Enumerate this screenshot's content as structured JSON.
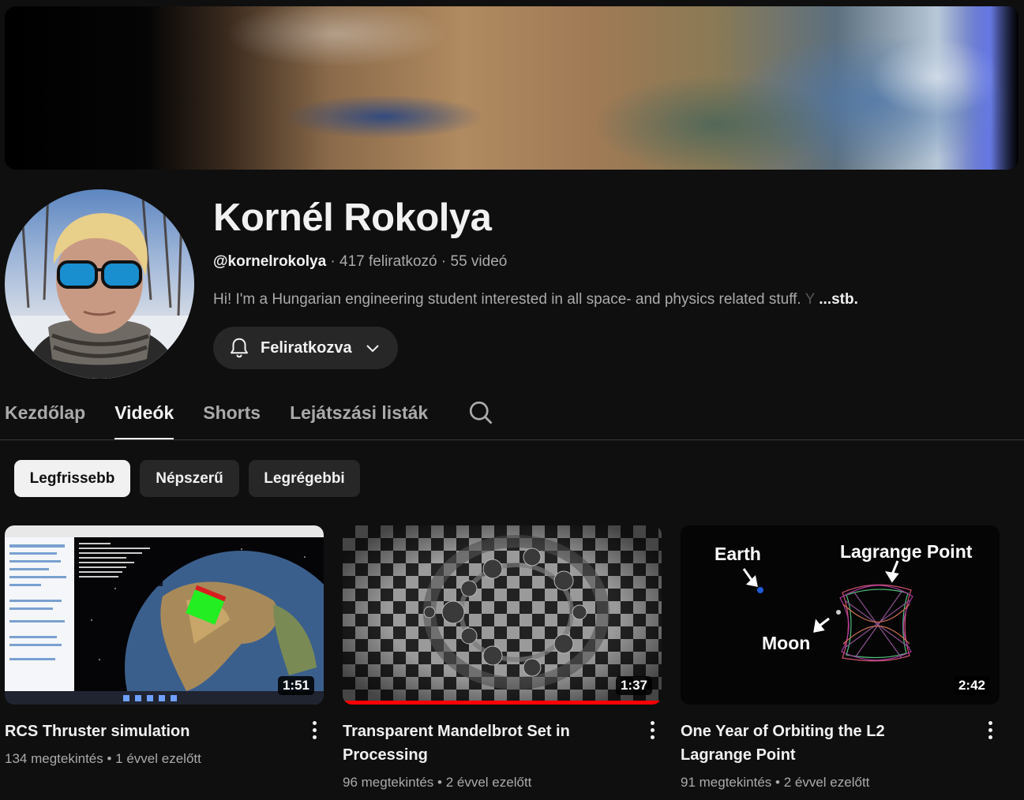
{
  "channel": {
    "name": "Kornél Rokolya",
    "handle": "@kornelrokolya",
    "subscribers": "417 feliratkozó",
    "videos_count": "55 videó",
    "description": "Hi! I'm a Hungarian engineering student interested in all space- and physics related stuff.",
    "description_fade": "Y",
    "more_label": "...stb.",
    "subscribe_label": "Feliratkozva"
  },
  "tabs": [
    {
      "label": "Kezdőlap"
    },
    {
      "label": "Videók"
    },
    {
      "label": "Shorts"
    },
    {
      "label": "Lejátszási listák"
    }
  ],
  "chips": [
    {
      "label": "Legfrissebb"
    },
    {
      "label": "Népszerű"
    },
    {
      "label": "Legrégebbi"
    }
  ],
  "videos": [
    {
      "title": "RCS Thruster simulation",
      "duration": "1:51",
      "views": "134 megtekintés",
      "age": "1 évvel ezelőtt"
    },
    {
      "title": "Transparent Mandelbrot Set in Processing",
      "duration": "1:37",
      "views": "96 megtekintés",
      "age": "2 évvel ezelőtt",
      "watched_fraction": 1.0
    },
    {
      "title": "One Year of Orbiting the L2 Lagrange Point",
      "duration": "2:42",
      "views": "91 megtekintés",
      "age": "2 évvel ezelőtt",
      "thumb_labels": {
        "earth": "Earth",
        "lagrange": "Lagrange Point",
        "moon": "Moon"
      }
    }
  ],
  "separator": "•",
  "meta_separator": "·",
  "colors": {
    "background": "#0f0f0f",
    "chip": "#272727",
    "progress": "#ff0000",
    "earth_dot": "#1e5bd6"
  }
}
